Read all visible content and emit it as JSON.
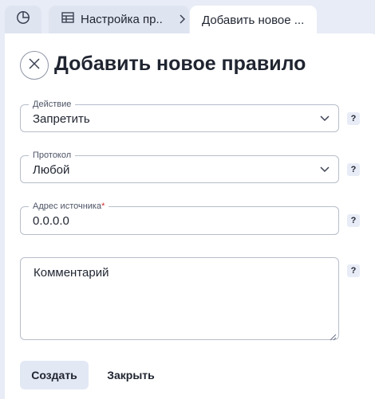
{
  "tabs": {
    "home_icon": "pie-chart-icon",
    "settings": {
      "label": "Настройка пр...",
      "icon": "table-icon"
    },
    "active": {
      "label": "Добавить новое ..."
    }
  },
  "page": {
    "title": "Добавить новое правило"
  },
  "form": {
    "action": {
      "label": "Действие",
      "value": "Запретить",
      "help": "?"
    },
    "protocol": {
      "label": "Протокол",
      "value": "Любой",
      "help": "?"
    },
    "source_address": {
      "label": "Адрес источника",
      "required_mark": "*",
      "value": "0.0.0.0",
      "help": "?"
    },
    "comment": {
      "placeholder": "Комментарий",
      "help": "?"
    }
  },
  "buttons": {
    "create": "Создать",
    "close": "Закрыть"
  },
  "colors": {
    "background": "#e8ecf6",
    "card": "#ffffff",
    "tab": "#dfe4f1",
    "required": "#d12c2c"
  }
}
